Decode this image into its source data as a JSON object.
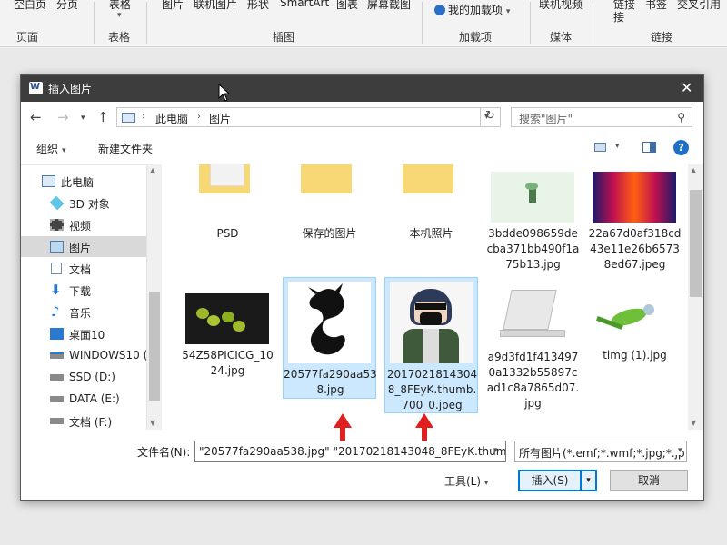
{
  "ribbon": {
    "items": [
      "空白页",
      "分页",
      "表格",
      "图片",
      "联机图片",
      "形状",
      "SmartArt",
      "图表",
      "屏幕截图",
      "我的加载项",
      "联机视频",
      "链接",
      "书签",
      "交叉引用"
    ],
    "link_sub": "接",
    "groups": [
      "页面",
      "表格",
      "插图",
      "加载项",
      "媒体",
      "链接"
    ]
  },
  "dialog": {
    "title": "插入图片",
    "close": "✕",
    "address": [
      "此电脑",
      "图片"
    ],
    "search_placeholder": "搜索\"图片\"",
    "organize": "组织",
    "new_folder": "新建文件夹"
  },
  "nav_items": [
    {
      "label": "此电脑",
      "icon": "computer-icon"
    },
    {
      "label": "3D 对象",
      "icon": "cube-icon"
    },
    {
      "label": "视频",
      "icon": "film-icon"
    },
    {
      "label": "图片",
      "icon": "pictures-icon"
    },
    {
      "label": "文档",
      "icon": "document-icon"
    },
    {
      "label": "下载",
      "icon": "download-icon"
    },
    {
      "label": "音乐",
      "icon": "music-icon"
    },
    {
      "label": "桌面10",
      "icon": "desktop-icon"
    },
    {
      "label": "WINDOWS10 (",
      "icon": "drive-icon"
    },
    {
      "label": "SSD (D:)",
      "icon": "drive-icon"
    },
    {
      "label": "DATA (E:)",
      "icon": "drive-icon"
    },
    {
      "label": "文档 (F:)",
      "icon": "drive-icon"
    }
  ],
  "files": [
    {
      "label": "PSD",
      "kind": "folder"
    },
    {
      "label": "保存的图片",
      "kind": "folder"
    },
    {
      "label": "本机照片",
      "kind": "folder"
    },
    {
      "label": "3bdde098659decba371bb490f1a75b13.jpg",
      "kind": "image"
    },
    {
      "label": "22a67d0af318cd43e11e26b65738ed67.jpeg",
      "kind": "image"
    },
    {
      "label": "54Z58PICICG_1024.jpg",
      "kind": "image"
    },
    {
      "label": "20577fa290aa538.jpg",
      "kind": "image"
    },
    {
      "label": "20170218143048_8FEyK.thumb.700_0.jpeg",
      "kind": "image"
    },
    {
      "label": "a9d3fd1f4134970a1332b55897cad1c8a7865d07.jpg",
      "kind": "image"
    },
    {
      "label": "timg (1).jpg",
      "kind": "image"
    }
  ],
  "filename": {
    "label": "文件名(N):",
    "value": "\"20577fa290aa538.jpg\" \"20170218143048_8FEyK.thumb"
  },
  "filter": "所有图片(*.emf;*.wmf;*.jpg;*.jp",
  "tools": "工具(L)",
  "insert": "插入(S)",
  "cancel": "取消",
  "colors": {
    "selection": "#cce8ff",
    "accent": "#0078d7",
    "annotation_arrow": "#e02020"
  }
}
